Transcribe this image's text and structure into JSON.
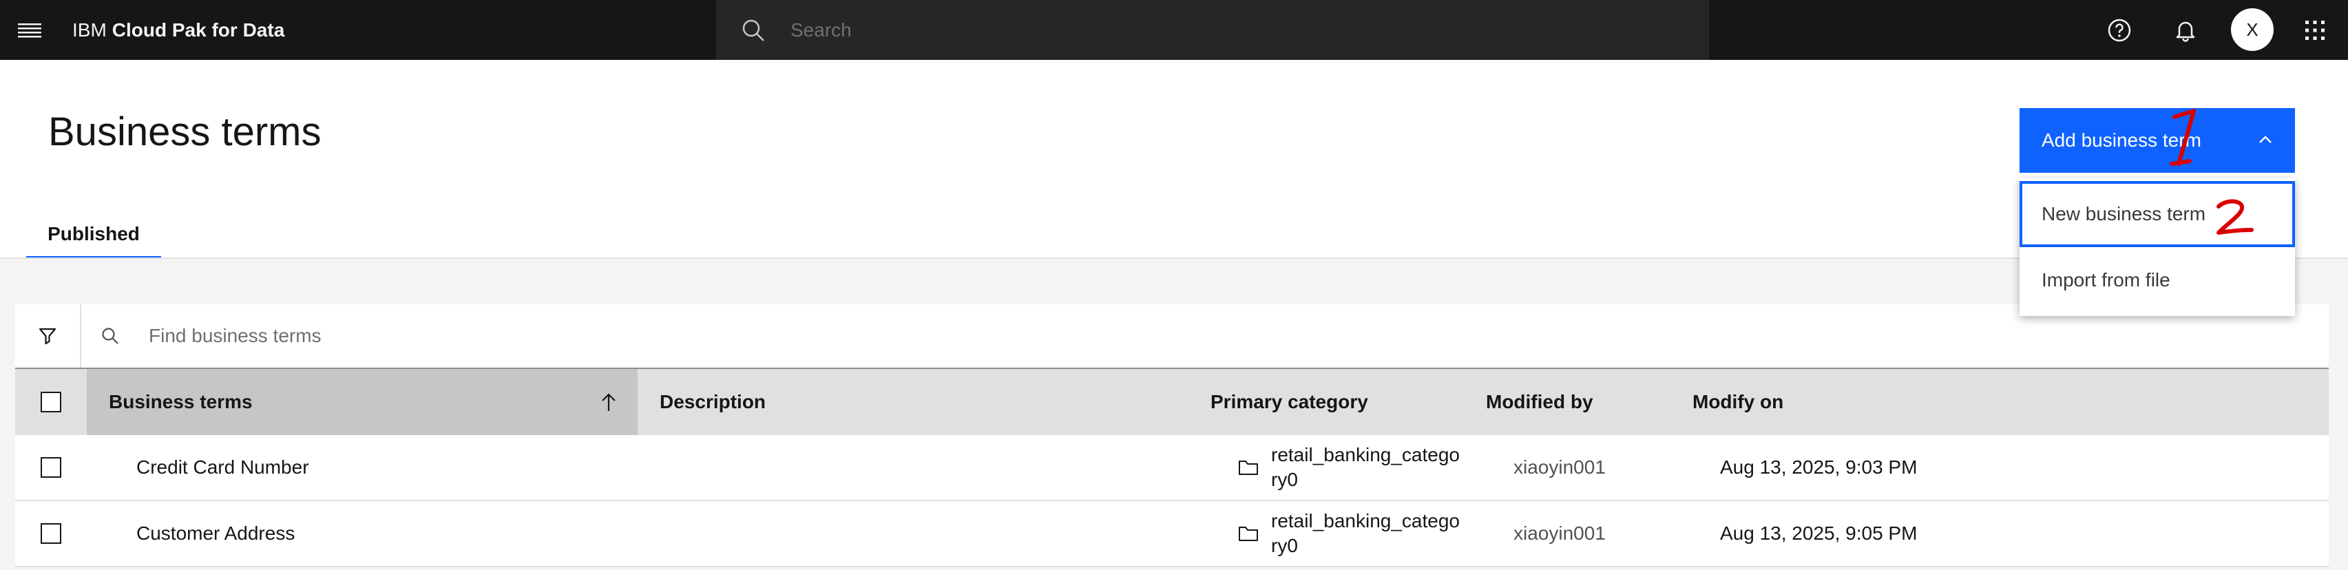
{
  "header": {
    "brand": "IBM",
    "product": "Cloud Pak for Data",
    "search_placeholder": "Search",
    "avatar_initial": "X",
    "icons": [
      "hamburger-menu-icon",
      "search-icon",
      "help-icon",
      "notification-icon",
      "app-switcher-icon"
    ]
  },
  "page": {
    "title": "Business terms",
    "tabs": [
      {
        "label": "Published",
        "selected": true
      }
    ]
  },
  "actions": {
    "add_label": "Add business term",
    "menu": [
      {
        "label": "New business term",
        "focused": true
      },
      {
        "label": "Import from file",
        "focused": false
      }
    ]
  },
  "toolbar": {
    "find_placeholder": "Find business terms"
  },
  "table": {
    "columns": [
      "Business terms",
      "Description",
      "Primary category",
      "Modified by",
      "Modify on"
    ],
    "sorted_column": "Business terms",
    "sort_direction": "ascending",
    "rows": [
      {
        "name": "Credit Card Number",
        "description": "",
        "category": "retail_banking_category0",
        "modified_by": "xiaoyin001",
        "modified_on": "Aug 13, 2025, 9:03 PM"
      },
      {
        "name": "Customer Address",
        "description": "",
        "category": "retail_banking_category0",
        "modified_by": "xiaoyin001",
        "modified_on": "Aug 13, 2025, 9:05 PM"
      }
    ]
  },
  "annotations": [
    "1",
    "2"
  ],
  "colors": {
    "header_bg": "#161616",
    "search_bg": "#262626",
    "primary_blue": "#0f62fe",
    "annotation_red": "#d90000",
    "band_bg": "#f4f4f4",
    "table_header_bg": "#e0e0e0",
    "sorted_header_bg": "#c6c6c6"
  }
}
